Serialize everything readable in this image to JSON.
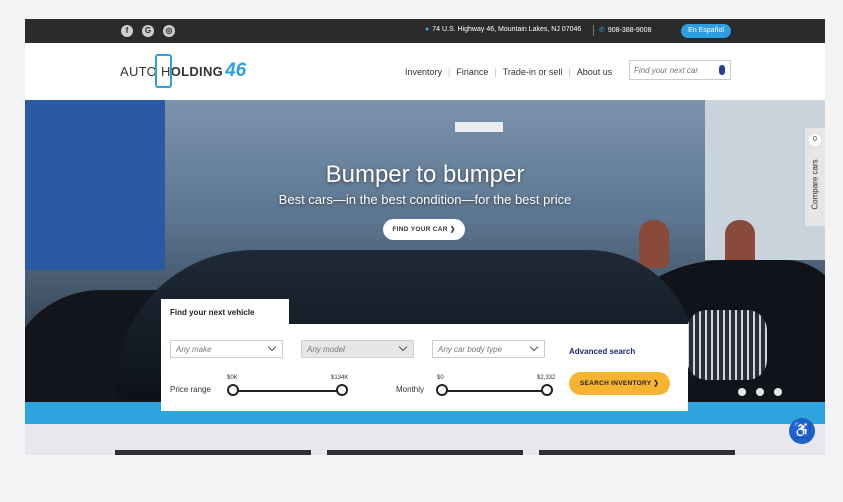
{
  "topbar": {
    "social_icons": [
      "facebook-icon",
      "google-icon",
      "instagram-icon"
    ],
    "social_glyphs": [
      "f",
      "G",
      "◎"
    ],
    "address": "74 U.S. Highway 46, Mountain Lakes, NJ 07046",
    "phone": "908-388-9008",
    "language_button": "En Español"
  },
  "header": {
    "logo": {
      "text_a": "AUTO H",
      "text_b": "LDING",
      "number": "46"
    },
    "nav": [
      "Inventory",
      "Finance",
      "Trade-in or sell",
      "About us"
    ],
    "search_placeholder": "Find your next car"
  },
  "hero": {
    "title": "Bumper to bumper",
    "subtitle": "Best cars—in the best condition—for the best price",
    "cta": "FIND YOUR CAR  ❯",
    "compare_count": "0",
    "compare_label": "Compare cars"
  },
  "search_panel": {
    "tab_label": "Find your next vehicle",
    "make_placeholder": "Any make",
    "model_placeholder": "Any model",
    "body_placeholder": "Any car body type",
    "advanced_link": "Advanced search",
    "price_range": {
      "label": "Price range",
      "min": "$0K",
      "max": "$134K"
    },
    "monthly": {
      "label": "Monthly",
      "min": "$0",
      "max": "$2,332"
    },
    "search_button": "SEARCH INVENTORY  ❯"
  },
  "colors": {
    "accent_blue": "#2fa3de",
    "button_orange": "#f6b431",
    "link_navy": "#1c2a70",
    "topbar_dark": "#2b2b2b"
  }
}
